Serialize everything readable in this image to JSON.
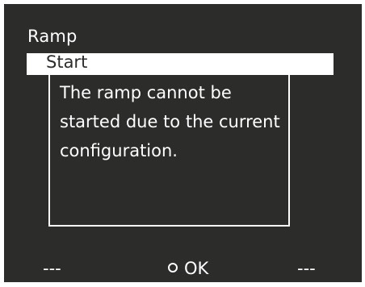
{
  "screen": {
    "title": "Ramp",
    "menu": {
      "selected_item": "Start"
    }
  },
  "dialog": {
    "message": "The ramp cannot be started due to the current configuration."
  },
  "softkeys": {
    "left": "---",
    "middle": "OK",
    "middle_icon": "circle-icon",
    "right": "---"
  },
  "colors": {
    "background": "#2c2c2b",
    "foreground": "#ffffff"
  }
}
